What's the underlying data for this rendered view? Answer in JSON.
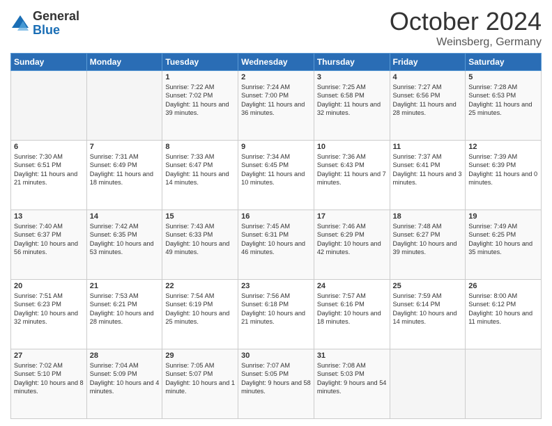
{
  "logo": {
    "general": "General",
    "blue": "Blue"
  },
  "title": {
    "month": "October 2024",
    "location": "Weinsberg, Germany"
  },
  "header_days": [
    "Sunday",
    "Monday",
    "Tuesday",
    "Wednesday",
    "Thursday",
    "Friday",
    "Saturday"
  ],
  "weeks": [
    [
      {
        "day": "",
        "info": ""
      },
      {
        "day": "",
        "info": ""
      },
      {
        "day": "1",
        "info": "Sunrise: 7:22 AM\nSunset: 7:02 PM\nDaylight: 11 hours and 39 minutes."
      },
      {
        "day": "2",
        "info": "Sunrise: 7:24 AM\nSunset: 7:00 PM\nDaylight: 11 hours and 36 minutes."
      },
      {
        "day": "3",
        "info": "Sunrise: 7:25 AM\nSunset: 6:58 PM\nDaylight: 11 hours and 32 minutes."
      },
      {
        "day": "4",
        "info": "Sunrise: 7:27 AM\nSunset: 6:56 PM\nDaylight: 11 hours and 28 minutes."
      },
      {
        "day": "5",
        "info": "Sunrise: 7:28 AM\nSunset: 6:53 PM\nDaylight: 11 hours and 25 minutes."
      }
    ],
    [
      {
        "day": "6",
        "info": "Sunrise: 7:30 AM\nSunset: 6:51 PM\nDaylight: 11 hours and 21 minutes."
      },
      {
        "day": "7",
        "info": "Sunrise: 7:31 AM\nSunset: 6:49 PM\nDaylight: 11 hours and 18 minutes."
      },
      {
        "day": "8",
        "info": "Sunrise: 7:33 AM\nSunset: 6:47 PM\nDaylight: 11 hours and 14 minutes."
      },
      {
        "day": "9",
        "info": "Sunrise: 7:34 AM\nSunset: 6:45 PM\nDaylight: 11 hours and 10 minutes."
      },
      {
        "day": "10",
        "info": "Sunrise: 7:36 AM\nSunset: 6:43 PM\nDaylight: 11 hours and 7 minutes."
      },
      {
        "day": "11",
        "info": "Sunrise: 7:37 AM\nSunset: 6:41 PM\nDaylight: 11 hours and 3 minutes."
      },
      {
        "day": "12",
        "info": "Sunrise: 7:39 AM\nSunset: 6:39 PM\nDaylight: 11 hours and 0 minutes."
      }
    ],
    [
      {
        "day": "13",
        "info": "Sunrise: 7:40 AM\nSunset: 6:37 PM\nDaylight: 10 hours and 56 minutes."
      },
      {
        "day": "14",
        "info": "Sunrise: 7:42 AM\nSunset: 6:35 PM\nDaylight: 10 hours and 53 minutes."
      },
      {
        "day": "15",
        "info": "Sunrise: 7:43 AM\nSunset: 6:33 PM\nDaylight: 10 hours and 49 minutes."
      },
      {
        "day": "16",
        "info": "Sunrise: 7:45 AM\nSunset: 6:31 PM\nDaylight: 10 hours and 46 minutes."
      },
      {
        "day": "17",
        "info": "Sunrise: 7:46 AM\nSunset: 6:29 PM\nDaylight: 10 hours and 42 minutes."
      },
      {
        "day": "18",
        "info": "Sunrise: 7:48 AM\nSunset: 6:27 PM\nDaylight: 10 hours and 39 minutes."
      },
      {
        "day": "19",
        "info": "Sunrise: 7:49 AM\nSunset: 6:25 PM\nDaylight: 10 hours and 35 minutes."
      }
    ],
    [
      {
        "day": "20",
        "info": "Sunrise: 7:51 AM\nSunset: 6:23 PM\nDaylight: 10 hours and 32 minutes."
      },
      {
        "day": "21",
        "info": "Sunrise: 7:53 AM\nSunset: 6:21 PM\nDaylight: 10 hours and 28 minutes."
      },
      {
        "day": "22",
        "info": "Sunrise: 7:54 AM\nSunset: 6:19 PM\nDaylight: 10 hours and 25 minutes."
      },
      {
        "day": "23",
        "info": "Sunrise: 7:56 AM\nSunset: 6:18 PM\nDaylight: 10 hours and 21 minutes."
      },
      {
        "day": "24",
        "info": "Sunrise: 7:57 AM\nSunset: 6:16 PM\nDaylight: 10 hours and 18 minutes."
      },
      {
        "day": "25",
        "info": "Sunrise: 7:59 AM\nSunset: 6:14 PM\nDaylight: 10 hours and 14 minutes."
      },
      {
        "day": "26",
        "info": "Sunrise: 8:00 AM\nSunset: 6:12 PM\nDaylight: 10 hours and 11 minutes."
      }
    ],
    [
      {
        "day": "27",
        "info": "Sunrise: 7:02 AM\nSunset: 5:10 PM\nDaylight: 10 hours and 8 minutes."
      },
      {
        "day": "28",
        "info": "Sunrise: 7:04 AM\nSunset: 5:09 PM\nDaylight: 10 hours and 4 minutes."
      },
      {
        "day": "29",
        "info": "Sunrise: 7:05 AM\nSunset: 5:07 PM\nDaylight: 10 hours and 1 minute."
      },
      {
        "day": "30",
        "info": "Sunrise: 7:07 AM\nSunset: 5:05 PM\nDaylight: 9 hours and 58 minutes."
      },
      {
        "day": "31",
        "info": "Sunrise: 7:08 AM\nSunset: 5:03 PM\nDaylight: 9 hours and 54 minutes."
      },
      {
        "day": "",
        "info": ""
      },
      {
        "day": "",
        "info": ""
      }
    ]
  ]
}
